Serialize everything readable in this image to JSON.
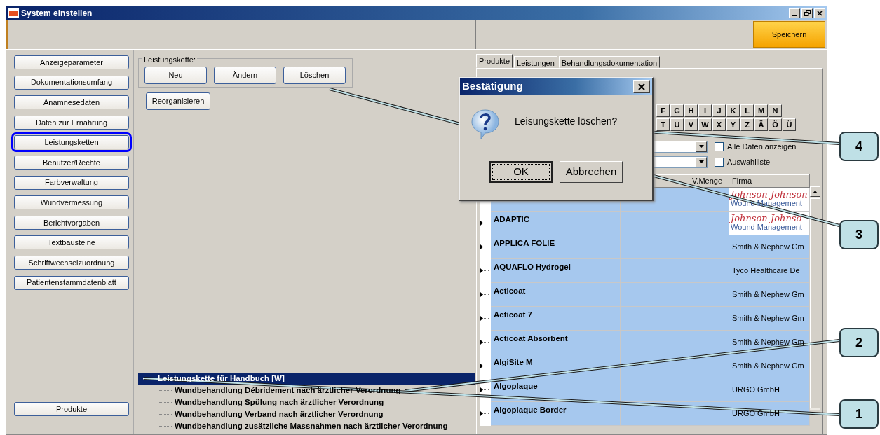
{
  "window": {
    "title": "System einstellen"
  },
  "toolbar": {
    "save_button": "Speichern"
  },
  "sidebar": {
    "items": [
      {
        "label": "Anzeigeparameter",
        "selected": false
      },
      {
        "label": "Dokumentationsumfang",
        "selected": false
      },
      {
        "label": "Anamnesedaten",
        "selected": false
      },
      {
        "label": "Daten zur Ernährung",
        "selected": false
      },
      {
        "label": "Leistungsketten",
        "selected": true
      },
      {
        "label": "Benutzer/Rechte",
        "selected": false
      },
      {
        "label": "Farbverwaltung",
        "selected": false
      },
      {
        "label": "Wundvermessung",
        "selected": false
      },
      {
        "label": "Berichtvorgaben",
        "selected": false
      },
      {
        "label": "Textbausteine",
        "selected": false
      },
      {
        "label": "Schriftwechselzuordnung",
        "selected": false
      },
      {
        "label": "Patientenstammdatenblatt",
        "selected": false
      }
    ],
    "bottom_item": {
      "label": "Produkte",
      "selected": false
    }
  },
  "chain_group": {
    "legend": "Leistungskette:",
    "buttons": [
      "Neu",
      "Ändern",
      "Löschen"
    ]
  },
  "reorganize_button": "Reorganisieren",
  "tree": {
    "items": [
      {
        "label": "Leistungskette für Handbuch [W]",
        "selected": true,
        "expanded": true,
        "children": [
          {
            "label": "Wundbehandlung Débridement nach ärztlicher Verordnung",
            "selected": false
          },
          {
            "label": "Wundbehandlung Spülung nach ärztlicher Verordnung",
            "selected": false
          },
          {
            "label": "Wundbehandlung Verband nach ärztlicher Verordnung",
            "selected": false
          },
          {
            "label": "Wundbehandlung zusätzliche Massnahmen nach ärztlicher Verordnung",
            "selected": false
          }
        ]
      }
    ]
  },
  "tabs": [
    {
      "label": "Produkte",
      "selected": true
    },
    {
      "label": "Leistungen",
      "selected": false
    },
    {
      "label": "Behandlungsdokumentation",
      "selected": false
    }
  ],
  "letters": [
    [
      "F",
      "G",
      "H",
      "I",
      "J",
      "K",
      "L",
      "M",
      "N"
    ],
    [
      "T",
      "U",
      "V",
      "W",
      "X",
      "Y",
      "Z",
      "Ä",
      "Ö",
      "Ü"
    ]
  ],
  "filters": [
    {
      "label": "Alle Daten anzeigen",
      "checked": false
    },
    {
      "label": "Auswahlliste",
      "checked": false
    }
  ],
  "grid": {
    "columns": [
      {
        "label": "V.Menge"
      },
      {
        "label": "Firma"
      }
    ],
    "rows": [
      {
        "kind": "logo",
        "logo": "Johnson-Johnson",
        "firm": "Wound Management"
      },
      {
        "name": "ADAPTIC",
        "kind": "logo",
        "logo": "Johnson-Johnso",
        "firm": "Wound Management"
      },
      {
        "name": "APPLICA FOLIE",
        "kind": "text",
        "firm": "Smith & Nephew Gm"
      },
      {
        "name": "AQUAFLO Hydrogel",
        "kind": "text",
        "firm": "Tyco Healthcare De"
      },
      {
        "name": "Acticoat",
        "kind": "text",
        "firm": "Smith & Nephew Gm"
      },
      {
        "name": "Acticoat 7",
        "kind": "text",
        "firm": "Smith & Nephew Gm"
      },
      {
        "name": "Acticoat Absorbent",
        "kind": "text",
        "firm": "Smith & Nephew Gm"
      },
      {
        "name": "AlgiSite M",
        "kind": "text",
        "firm": "Smith & Nephew Gm"
      },
      {
        "name": "Algoplaque",
        "kind": "text",
        "firm": "URGO GmbH"
      },
      {
        "name": "Algoplaque Border",
        "kind": "text",
        "firm": "URGO GmbH"
      }
    ]
  },
  "dialog": {
    "title": "Bestätigung",
    "message": "Leisungskette löschen?",
    "buttons": [
      {
        "label": "OK",
        "focused": true
      },
      {
        "label": "Abbrechen",
        "focused": false
      }
    ]
  },
  "callouts": [
    {
      "number": "4"
    },
    {
      "number": "3"
    },
    {
      "number": "2"
    },
    {
      "number": "1"
    }
  ]
}
